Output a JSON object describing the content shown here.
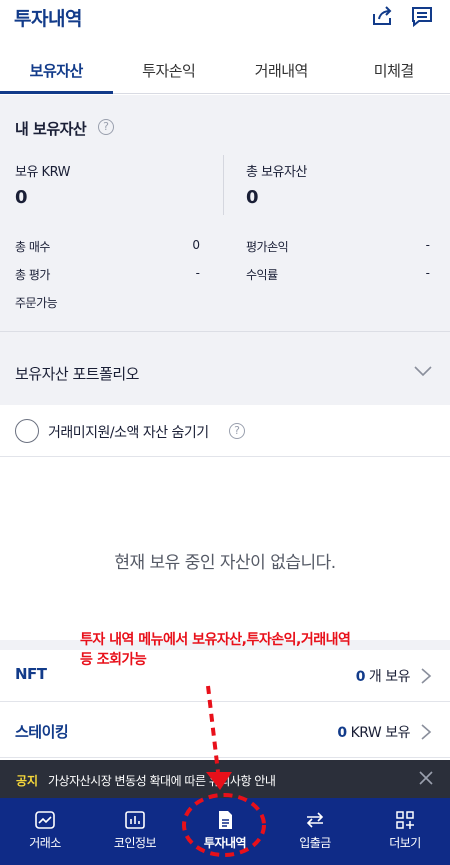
{
  "header": {
    "title": "투자내역",
    "share_icon": "share-icon",
    "memo_icon": "memo-icon"
  },
  "tabs": [
    {
      "label": "보유자산",
      "active": true
    },
    {
      "label": "투자손익",
      "active": false
    },
    {
      "label": "거래내역",
      "active": false
    },
    {
      "label": "미체결",
      "active": false
    }
  ],
  "summary": {
    "title": "내 보유자산",
    "held_krw_label": "보유 KRW",
    "held_krw_value": "0",
    "total_assets_label": "총 보유자산",
    "total_assets_value": "0",
    "total_buy_label": "총 매수",
    "total_buy_value": "0",
    "eval_pl_label": "평가손익",
    "eval_pl_value": "-",
    "total_eval_label": "총 평가",
    "total_eval_value": "-",
    "return_label": "수익률",
    "return_value": "-",
    "orderable_label": "주문가능"
  },
  "portfolio": {
    "label": "보유자산 포트폴리오"
  },
  "filter": {
    "label": "거래미지원/소액 자산 숨기기"
  },
  "empty_message": "현재 보유 중인 자산이 없습니다.",
  "annotation": {
    "line1": "투자 내역 메뉴에서 보유자산,투자손익,거래내역",
    "line2": "등 조회가능"
  },
  "rows": [
    {
      "name": "NFT",
      "count": "0",
      "suffix": "개 보유"
    },
    {
      "name": "스테이킹",
      "count": "0",
      "suffix": "KRW 보유"
    }
  ],
  "notice": {
    "tag": "공지",
    "text": "가상자산시장 변동성 확대에 따른 유의사항 안내"
  },
  "nav": [
    {
      "label": "거래소",
      "icon": "chart-line-icon",
      "active": false
    },
    {
      "label": "코인정보",
      "icon": "bar-chart-icon",
      "active": false
    },
    {
      "label": "투자내역",
      "icon": "document-icon",
      "active": true
    },
    {
      "label": "입출금",
      "icon": "transfer-arrows-icon",
      "active": false
    },
    {
      "label": "더보기",
      "icon": "grid-plus-icon",
      "active": false
    }
  ],
  "colors": {
    "brand": "#123b8a",
    "nav_bg": "#0f2b87",
    "annotation_red": "#e8101a",
    "notice_tag": "#f5d73b"
  }
}
